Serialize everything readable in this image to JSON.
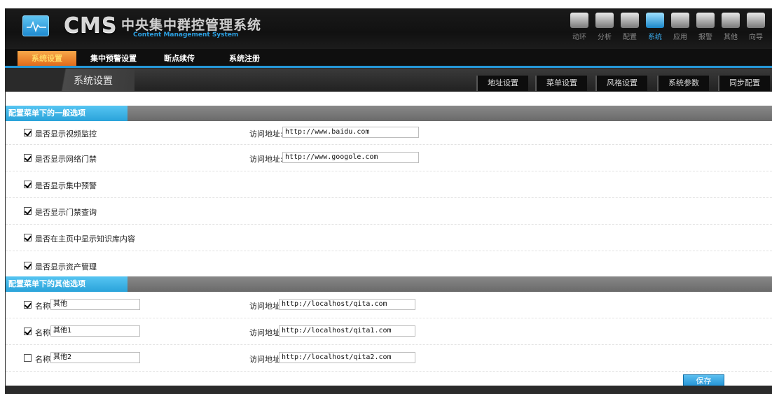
{
  "header": {
    "logo_text": "CMS",
    "logo_cn": "中央集中群控管理系统",
    "logo_en": "Content Management System",
    "topnav": [
      {
        "label": "动环",
        "icon": "server-icon"
      },
      {
        "label": "分析",
        "icon": "chart-icon"
      },
      {
        "label": "配置",
        "icon": "config-icon"
      },
      {
        "label": "系统",
        "icon": "system-icon",
        "active": true
      },
      {
        "label": "应用",
        "icon": "app-icon"
      },
      {
        "label": "报警",
        "icon": "alarm-icon"
      },
      {
        "label": "其他",
        "icon": "other-icon"
      },
      {
        "label": "向导",
        "icon": "wizard-icon"
      }
    ]
  },
  "tabs": [
    {
      "label": "系统设置",
      "active": true
    },
    {
      "label": "集中预警设置"
    },
    {
      "label": "断点续传"
    },
    {
      "label": "系统注册"
    }
  ],
  "subheader": {
    "title": "系统设置",
    "tabs": [
      "地址设置",
      "菜单设置",
      "风格设置",
      "系统参数",
      "同步配置"
    ]
  },
  "section1": {
    "title": "配置菜单下的一般选项",
    "addr_label": "访问地址:",
    "rows": [
      {
        "label": "是否显示视频监控",
        "checked": true,
        "url": "http://www.baidu.com"
      },
      {
        "label": "是否显示网络门禁",
        "checked": true,
        "url": "http://www.googole.com"
      },
      {
        "label": "是否显示集中预警",
        "checked": true
      },
      {
        "label": "是否显示门禁查询",
        "checked": true
      },
      {
        "label": "是否在主页中显示知识库内容",
        "checked": true
      },
      {
        "label": "是否显示资产管理",
        "checked": true
      }
    ]
  },
  "section2": {
    "title": "配置菜单下的其他选项",
    "name_label": "名称",
    "addr_label": "访问地址:",
    "rows": [
      {
        "name": "其他",
        "checked": true,
        "url": "http://localhost/qita.com"
      },
      {
        "name": "其他1",
        "checked": true,
        "url": "http://localhost/qita1.com"
      },
      {
        "name": "其他2",
        "checked": false,
        "url": "http://localhost/qita2.com"
      }
    ]
  },
  "save_label": "保存",
  "colors": {
    "accent": "#2598d8",
    "active_tab": "#e06818",
    "section_label": "#2aa3da"
  }
}
